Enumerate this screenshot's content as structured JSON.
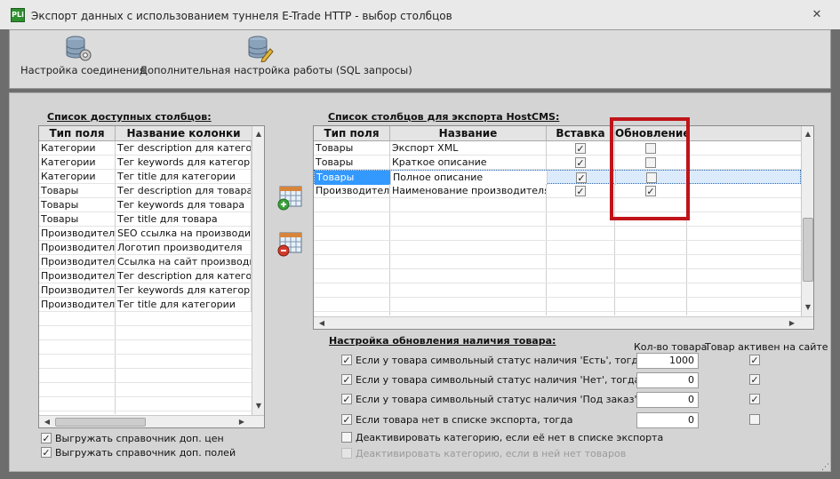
{
  "window": {
    "icon_text": "PLi",
    "title": "Экспорт данных с использованием туннеля E-Trade HTTP - выбор столбцов",
    "close_glyph": "✕"
  },
  "toolbar": {
    "connection_label": "Настройка соединения",
    "advanced_label": "Дополнительная настройка работы (SQL запросы)",
    "connection_icon": "database-gear-icon",
    "advanced_icon": "database-sql-icon"
  },
  "available": {
    "title": "Список доступных столбцов:",
    "headers": [
      "Тип поля",
      "Название колонки"
    ],
    "rows": [
      [
        "Категории",
        "Тег description для категории"
      ],
      [
        "Категории",
        "Тег keywords для категории"
      ],
      [
        "Категории",
        "Тег title для категории"
      ],
      [
        "Товары",
        "Тег description для товара"
      ],
      [
        "Товары",
        "Тег keywords для товара"
      ],
      [
        "Товары",
        "Тег title для товара"
      ],
      [
        "Производители",
        "SEO ссылка на производителя"
      ],
      [
        "Производители",
        "Логотип производителя"
      ],
      [
        "Производители",
        "Ссылка на сайт производителя"
      ],
      [
        "Производители",
        "Тег description для категории"
      ],
      [
        "Производители",
        "Тег keywords для категории"
      ],
      [
        "Производители",
        "Тег title для категории"
      ]
    ]
  },
  "export": {
    "title": "Список столбцов для экспорта HostCMS:",
    "headers": [
      "Тип поля",
      "Название",
      "Вставка",
      "Обновление"
    ],
    "rows": [
      {
        "type": "Товары",
        "name": "Экспорт XML",
        "insert": true,
        "update": false
      },
      {
        "type": "Товары",
        "name": "Краткое описание",
        "insert": true,
        "update": false
      },
      {
        "type": "Товары",
        "name": "Полное описание",
        "insert": true,
        "update": false
      },
      {
        "type": "Производители",
        "name": "Наименование производителя",
        "insert": true,
        "update": true
      }
    ],
    "selected_row": 2,
    "highlight_color": "#c0141a"
  },
  "add_icon": "add-column-icon",
  "remove_icon": "remove-column-icon",
  "stock": {
    "title": "Настройка обновления наличия товара:",
    "col_qty": "Кол-во товара",
    "col_active": "Товар активен на сайте",
    "rows": [
      {
        "label": "Если у товара символьный статус наличия 'Есть', тогда",
        "checked": true,
        "qty": "1000",
        "active": true
      },
      {
        "label": "Если у товара символьный статус наличия 'Нет', тогда",
        "checked": true,
        "qty": "0",
        "active": true
      },
      {
        "label": "Если у товара символьный статус наличия 'Под заказ', тогда",
        "checked": true,
        "qty": "0",
        "active": true
      },
      {
        "label": "Если товара нет в списке экспорта, тогда",
        "checked": true,
        "qty": "0",
        "active": false
      }
    ],
    "deactivate_label": "Деактивировать категорию, если её нет в списке экспорта",
    "deactivate_empty_label": "Деактивировать категорию, если в ней нет товаров"
  },
  "options": {
    "export_prices_label": "Выгружать справочник доп. цен",
    "export_fields_label": "Выгружать справочник доп. полей"
  },
  "check_glyph": "✓"
}
